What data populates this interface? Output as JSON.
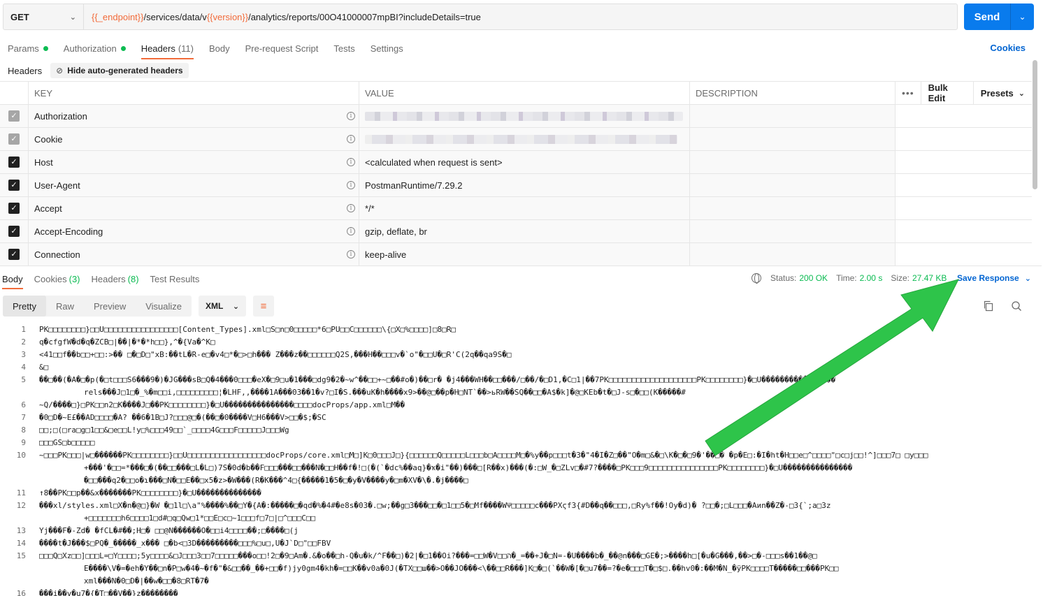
{
  "request": {
    "method": "GET",
    "url_parts": [
      {
        "text": "{{_endpoint}}",
        "var": true
      },
      {
        "text": "/services/data/v",
        "var": false
      },
      {
        "text": "{{version}}",
        "var": true
      },
      {
        "text": "/analytics/reports/00O41000007mpBI?includeDetails=true",
        "var": false
      }
    ],
    "send_label": "Send"
  },
  "tabs": {
    "params": "Params",
    "authorization": "Authorization",
    "headers": "Headers",
    "headers_count": "(11)",
    "body": "Body",
    "prerequest": "Pre-request Script",
    "tests": "Tests",
    "settings": "Settings",
    "cookies": "Cookies"
  },
  "headers_section": {
    "title": "Headers",
    "hide_label": "Hide auto-generated headers",
    "columns": {
      "key": "KEY",
      "value": "VALUE",
      "description": "DESCRIPTION"
    },
    "tools": {
      "more": "•••",
      "bulk_edit": "Bulk Edit",
      "presets": "Presets"
    },
    "rows": [
      {
        "key": "Authorization",
        "value": "",
        "blurred": true,
        "enabled": false
      },
      {
        "key": "Cookie",
        "value": "",
        "blurred": true,
        "enabled": false
      },
      {
        "key": "Host",
        "value": "<calculated when request is sent>",
        "blurred": false,
        "enabled": true
      },
      {
        "key": "User-Agent",
        "value": "PostmanRuntime/7.29.2",
        "blurred": false,
        "enabled": true
      },
      {
        "key": "Accept",
        "value": "*/*",
        "blurred": false,
        "enabled": true
      },
      {
        "key": "Accept-Encoding",
        "value": "gzip, deflate, br",
        "blurred": false,
        "enabled": true
      },
      {
        "key": "Connection",
        "value": "keep-alive",
        "blurred": false,
        "enabled": true
      }
    ]
  },
  "response": {
    "tabs": {
      "body": "Body",
      "cookies": "Cookies",
      "cookies_count": "(3)",
      "headers": "Headers",
      "headers_count": "(8)",
      "test_results": "Test Results"
    },
    "status_label": "Status:",
    "status_value": "200 OK",
    "time_label": "Time:",
    "time_value": "2.00 s",
    "size_label": "Size:",
    "size_value": "27.47 KB",
    "save_label": "Save Response",
    "views": [
      "Pretty",
      "Raw",
      "Preview",
      "Visualize"
    ],
    "active_view": "Pretty",
    "format": "XML",
    "lines": [
      {
        "n": "1",
        "t": [
          "PK□□□□□□□□}□□U□□□□□□□□□□□□□□□□[Content_Types].xml□S□n□0□□□□□*6□PU□□C□□□□□□\\{□X□%□□□□]□8□R□"
        ]
      },
      {
        "n": "2",
        "t": [
          "q�cfgfW�d�q�ZCB□|��|�*�*h□□},^�{Va�^K□"
        ]
      },
      {
        "n": "3",
        "t": [
          "<41□□f��b□□+□□:>�� □�□D□\"xB:��tL�R-e□�v4□*�□>□h���   Z���z��□□□□□□Q2S,���H��□□□v�`o\"�□□U�□R'C(2q��qa9S�□"
        ]
      },
      {
        "n": "4",
        "t": [
          "&□"
        ]
      },
      {
        "n": "5",
        "t": [
          "��□��(�A�□�p(�□t□□□S6���9�)�JG���sB□Q�4���0□□□�eX�□9□u�1���□dg9�2�~w^��□□+~□��#o�)��□r�   �j4���WH��□□���/□��/�□D1,�C□1|��7PK□□□□□□□□□□□□□□□□□□□PK□□□□□□□□}�□U����������������",
          "rels���J□1□�_%�m□□i,□□□□□□□□□¦�LHF,,����1A���03��1�v?□I�S.���uK�h����x9>��@□��p�H□NT`��>ьRW��SQ��□□�A$�k]�@□KEb�t�□J-s□�□□(K�����#"
        ]
      },
      {
        "n": "6",
        "t": [
          "~Q/����□}□PK□□n2□K����J□��PK□□□□□□□□}�□U���������������□□□□docProps/app.xml□M��"
        ]
      },
      {
        "n": "7",
        "t": [
          "�0□D�~E£��AD□□□□�A? ��6�1B□J?□□□@□�(��□�0����V□H6���V>□□�$;�SC"
        ]
      },
      {
        "n": "8",
        "t": [
          "□□;□(□ra□g□1□□&□e□□L!y□%□□□49□□`_□□□□4G□□□F□□□□□J□□□Wg"
        ]
      },
      {
        "n": "9",
        "t": [
          "□□□GS□b□□□□□"
        ]
      },
      {
        "n": "10",
        "t": [
          "~□□□PK□□□|w□������PK□□□□□□□□}□□U□□□□□□□□□□□□□□□□□docProps/core.xml□M□]K□0□□□J□}{□□□□□□Q□□□□□L□□□b□A□□□□M□�%y��p□□□t�3�\"4�I�Z□��\"O�m□&�□\\K�□�□9�'��□�   �p�E□:�I�ht�H□□e□^□□□□\"□c□j□□!^]□□□7□ □y□□□",
          "+���'�□□=*���□�(��□□���□L�L□)7S�0d�b��F□□□���□□���N�□□H��f�!□(�(`�dc%��aq}�ҡ�i\"��)���□[R��x)���(�:□W_�□ZLv□�#7?����□PK□□□9□□□□□□□□□□□□□□□PK□□□□□□□□}�□U���������������",
          "�□□���q2�□□o�ɿ���□N�□□E��□x5�z>�W���(R�K���^4□{�����1�5�□�y�V����y�□m�XV�\\�.�j����□"
        ]
      },
      {
        "n": "11",
        "t": [
          "↑8��PK□□p��&x�������PK□□□□□□□□}�□U��������������"
        ]
      },
      {
        "n": "12",
        "t": [
          "���xl/styles.xml□X�n�@□}�W �□1l□\\a\"%����%��□Y�{A�:�����□�qd�%�4#�e8s�03�.□w;��g□3���□□�□1□□5�□Mf����WѰ□□□□□c���PXϛf3{#D��q��□□□,□Ry%f��!Oy�d)� ?□□�;□L□□□�Aͷn��Z�-□3{`;a□3z",
          "+□□□□□□□h6□□□□1□d#□q□Qw□1*□□E□c□~1□□□f□7□|□^□□□C□□"
        ]
      },
      {
        "n": "13",
        "t": [
          "Yj���F�-Zd� �fCL�#��;H□� □□@N������O�□□i4□□□□��;□����□(j"
        ]
      },
      {
        "n": "14",
        "t": [
          "����t�J���$□PQ�_�����_x��� □�b<□3D���������□□□%□u□,U�J`D□\"□□FBV"
        ]
      },
      {
        "n": "15",
        "t": [
          "□□□Q□Xz□□]□□□L=□Y□□□□;5y□□□□&□J□□□3□□7□□□□□���o□□!2□�9□Am�.&�o��□h-Q�u�k/^F��□)�2|�□1��Oi?���=□□W�V□□ה�_=��+J�□N=-�U����b�_��@n���□GE�;>����h□[�u�G���,��>□�-□□□s��1��@□",
          "E����\\V�=�eh�Y��□n�P□w�4�~�f�\"�&□□��_��+□□�f)jy0gm4�kh�=□□K��v0a�0J(�TX□□ш��>O��JO���<\\��□□R���]K□�□(`��W�[�□u7��=?�e�□□□T�□$□.��hv0�:��M�N_�ÿPK□□□□T�����□□���PK□□",
          "xml���N�0□D�|��w�□□�8□RT�7�"
        ]
      },
      {
        "n": "16",
        "t": [
          "���i��v�u7�{�T□��V��}z��������"
        ]
      }
    ]
  },
  "colors": {
    "send_blue": "#097bed",
    "accent_orange": "#f26b3a",
    "status_green": "#0cbb52",
    "link_blue": "#0265d2",
    "annotation_arrow": "#2ec44a"
  }
}
